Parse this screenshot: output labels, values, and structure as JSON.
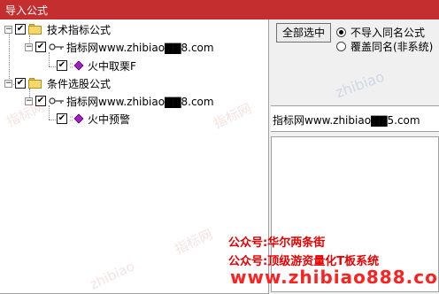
{
  "window": {
    "title": "导入公式"
  },
  "tree": {
    "nodes": [
      {
        "label": "技术指标公式",
        "checked": true,
        "icon": "folder-icon"
      },
      {
        "label": "指标网www.zhibiao▇▇8.com",
        "checked": true,
        "icon": "key-icon"
      },
      {
        "label": "火中取栗F",
        "checked": true,
        "icon": "diamond-icon"
      },
      {
        "label": "条件选股公式",
        "checked": true,
        "icon": "folder-icon"
      },
      {
        "label": "指标网www.zhibiao▇▇8.com",
        "checked": true,
        "icon": "key-icon"
      },
      {
        "label": "火中预警",
        "checked": true,
        "icon": "diamond-icon"
      }
    ]
  },
  "controls": {
    "select_all_label": "全部选中",
    "radio_options": [
      {
        "label": "不导入同名公式",
        "selected": true
      },
      {
        "label": "覆盖同名(非系统)",
        "selected": false
      }
    ]
  },
  "source_text": "指标网www.zhibiao▇▇5.com",
  "watermark": {
    "text_a": "指标网",
    "text_b": "zhibiao"
  },
  "promo": {
    "line1": "公众号:华尔两条街",
    "line2": "公众号:顶级游资量化T板系统",
    "url": "www.zhibiao888.com"
  },
  "colors": {
    "titlebar": "#c42e2e",
    "promo": "#e60000"
  }
}
